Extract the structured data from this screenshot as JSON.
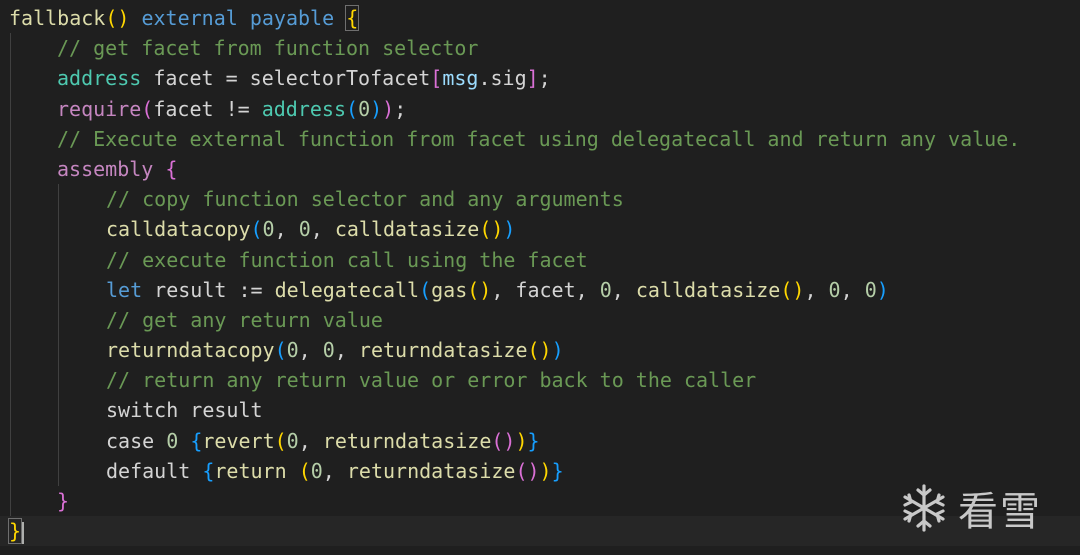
{
  "editor": {
    "theme": "dark",
    "background": "#1f1f1f",
    "watermark_text": "看雪"
  },
  "code": {
    "l1": {
      "fn": "fallback",
      "p_open": "(",
      "p_close": ")",
      "sp1": " ",
      "mod1": "external",
      "sp2": " ",
      "mod2": "payable",
      "sp3": " ",
      "brace": "{"
    },
    "l2": {
      "comment": "// get facet from function selector"
    },
    "l3": {
      "type": "address",
      "rest": " facet = selectorTofacet",
      "b_open": "[",
      "mem": "msg",
      "dot": ".sig",
      "b_close": "]",
      "semi": ";"
    },
    "l4": {
      "ctl": "require",
      "p_open": "(",
      "v1": "facet != ",
      "type": "address",
      "p2_open": "(",
      "num": "0",
      "p2_close": ")",
      "p_close": ")",
      "semi": ";"
    },
    "l5": {
      "comment": "// Execute external function from facet using delegatecall and return any value."
    },
    "l6": {
      "ctl": "assembly",
      "sp": " ",
      "brace": "{"
    },
    "l7": {
      "comment": "// copy function selector and any arguments"
    },
    "l8": {
      "fn": "calldatacopy",
      "p_open": "(",
      "n1": "0",
      "c1": ", ",
      "n2": "0",
      "c2": ", ",
      "fn2": "calldatasize",
      "p2_open": "(",
      "p2_close": ")",
      "p_close": ")"
    },
    "l9": {
      "comment": "// execute function call using the facet"
    },
    "l10": {
      "kw": "let",
      "rest": " result := ",
      "fn": "delegatecall",
      "p_open": "(",
      "fn2": "gas",
      "p2a": "(",
      "p2b": ")",
      "c1": ", facet, ",
      "n1": "0",
      "c2": ", ",
      "fn3": "calldatasize",
      "p3a": "(",
      "p3b": ")",
      "c3": ", ",
      "n2": "0",
      "c4": ", ",
      "n3": "0",
      "p_close": ")"
    },
    "l11": {
      "comment": "// get any return value"
    },
    "l12": {
      "fn": "returndatacopy",
      "p_open": "(",
      "n1": "0",
      "c1": ", ",
      "n2": "0",
      "c2": ", ",
      "fn2": "returndatasize",
      "p2_open": "(",
      "p2_close": ")",
      "p_close": ")"
    },
    "l13": {
      "comment": "// return any return value or error back to the caller"
    },
    "l14": {
      "text": "switch result"
    },
    "l15": {
      "kw": "case",
      "sp": " ",
      "num": "0",
      "sp2": " ",
      "b_open": "{",
      "fn": "revert",
      "p_open": "(",
      "n1": "0",
      "c1": ", ",
      "fn2": "returndatasize",
      "p2_open": "(",
      "p2_close": ")",
      "p_close": ")",
      "b_close": "}"
    },
    "l16": {
      "kw": "default",
      "sp": " ",
      "b_open": "{",
      "fn": "return",
      "sp2": " ",
      "p_open": "(",
      "n1": "0",
      "c1": ", ",
      "fn2": "returndatasize",
      "p2_open": "(",
      "p2_close": ")",
      "p_close": ")",
      "b_close": "}"
    },
    "l17": {
      "brace": "}"
    },
    "l18": {
      "brace": "}"
    }
  }
}
